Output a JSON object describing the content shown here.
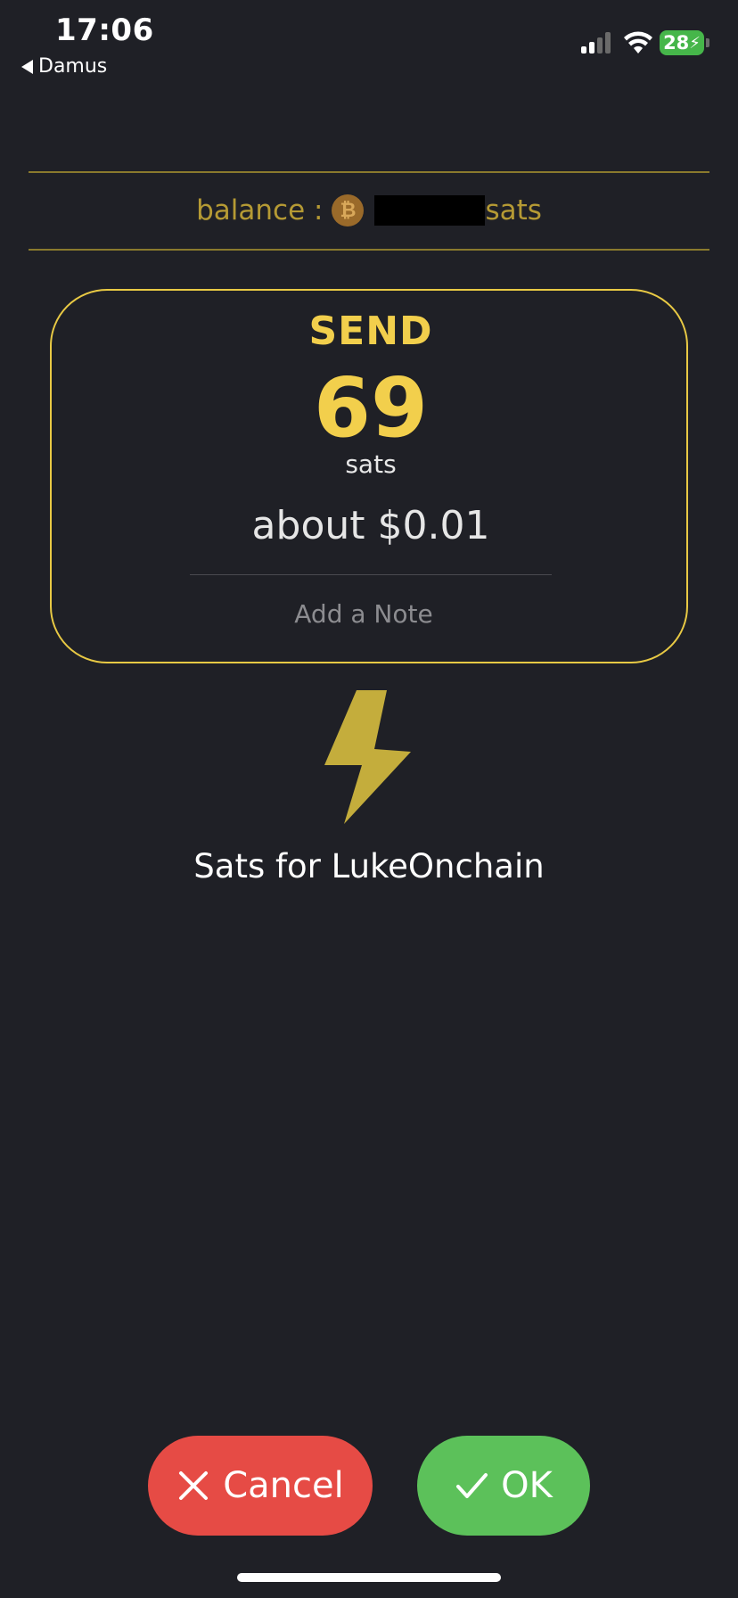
{
  "status_bar": {
    "time": "17:06",
    "back_label": "Damus",
    "battery_level": "28"
  },
  "balance": {
    "label": "balance :",
    "unit": "sats",
    "icon": "bitcoin-icon"
  },
  "send": {
    "label": "SEND",
    "amount": "69",
    "unit": "sats",
    "fiat": "about $0.01",
    "note_placeholder": "Add a Note"
  },
  "recipient": {
    "icon": "lightning-bolt-icon",
    "text": "Sats for LukeOnchain"
  },
  "actions": {
    "cancel_label": "Cancel",
    "ok_label": "OK"
  },
  "colors": {
    "background": "#1f2026",
    "accent": "#f2cf4c",
    "balance_text": "#b59a34",
    "cancel": "#e64b45",
    "ok": "#5cc15a"
  }
}
